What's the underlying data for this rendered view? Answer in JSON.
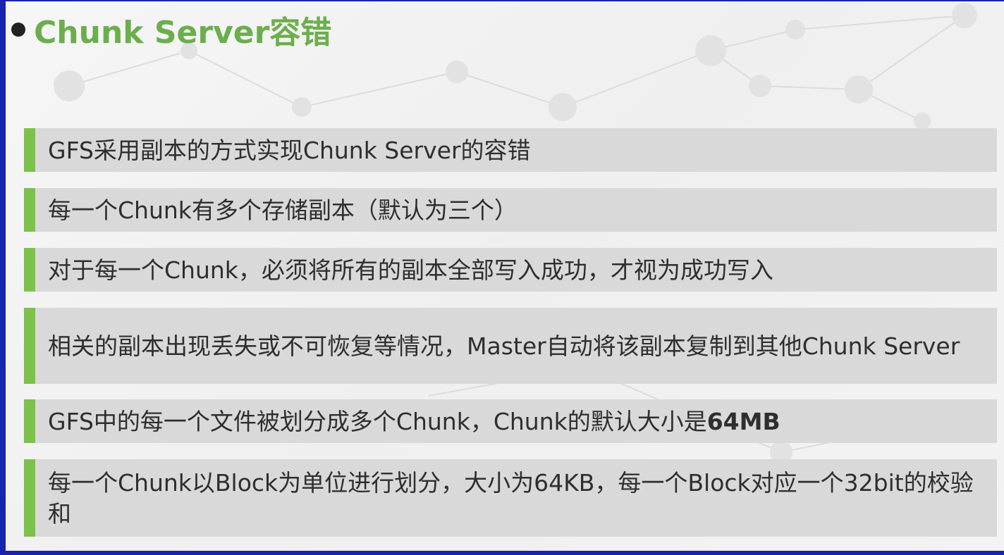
{
  "slide": {
    "title": "Chunk Server容错",
    "items": [
      {
        "text": "GFS采用副本的方式实现Chunk Server的容错"
      },
      {
        "text": "每一个Chunk有多个存储副本（默认为三个）"
      },
      {
        "text": "对于每一个Chunk，必须将所有的副本全部写入成功，才视为成功写入"
      },
      {
        "text": "相关的副本出现丢失或不可恢复等情况，Master自动将该副本复制到其他Chunk Server"
      },
      {
        "text": "GFS中的每一个文件被划分成多个Chunk，Chunk的默认大小是",
        "bold": "64MB"
      },
      {
        "text": "每一个Chunk以Block为单位进行划分，大小为64KB，每一个Block对应一个32bit的校验和"
      }
    ]
  },
  "colors": {
    "accent": "#7cc24a",
    "title": "#6cae4c",
    "item_bg": "#d9d9d9",
    "frame": "#1a22b0"
  }
}
